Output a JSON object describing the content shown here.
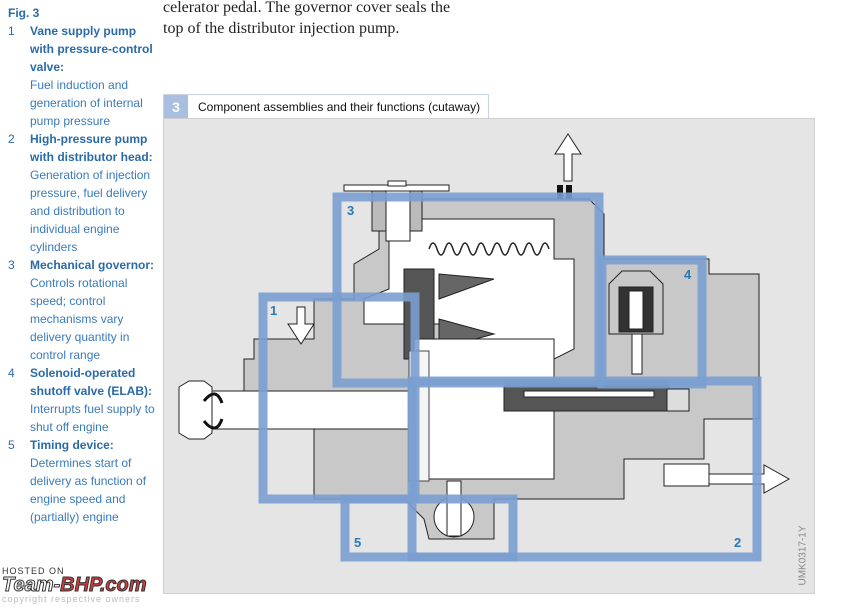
{
  "sidebar": {
    "fig_label": "Fig. 3",
    "items": [
      {
        "num": "1",
        "title": "Vane supply pump with pressure-control valve:",
        "desc": "Fuel induction and generation of internal pump pressure"
      },
      {
        "num": "2",
        "title": "High-pressure pump with distributor head:",
        "desc": "Generation of injection pressure, fuel delivery and distribution to individual engine cylinders"
      },
      {
        "num": "3",
        "title": "Mechanical governor:",
        "desc": "Controls rotational speed; control mechanisms vary delivery quantity in control range"
      },
      {
        "num": "4",
        "title": "Solenoid-operated shutoff valve (ELAB):",
        "desc": "Interrupts fuel supply to shut off engine"
      },
      {
        "num": "5",
        "title": "Timing device:",
        "desc": "Determines start of delivery as function of engine speed and (partially) engine"
      }
    ]
  },
  "body_text": {
    "line1": "celerator pedal. The governor cover seals the",
    "line2": "top of the distributor injection pump."
  },
  "figure": {
    "number": "3",
    "caption": "Component assemblies and their functions (cutaway)",
    "credit": "UMK0317-1Y",
    "region_labels": [
      "1",
      "2",
      "3",
      "4",
      "5"
    ],
    "colors": {
      "region_outline": "#7a9fcf",
      "label_blue": "#2a7ab8",
      "background": "#e5e5e5"
    }
  },
  "watermark": {
    "host": "HOSTED ON",
    "brand_left": "Team-",
    "brand_right": "BHP.com",
    "copyright": "copyright respective owners"
  }
}
